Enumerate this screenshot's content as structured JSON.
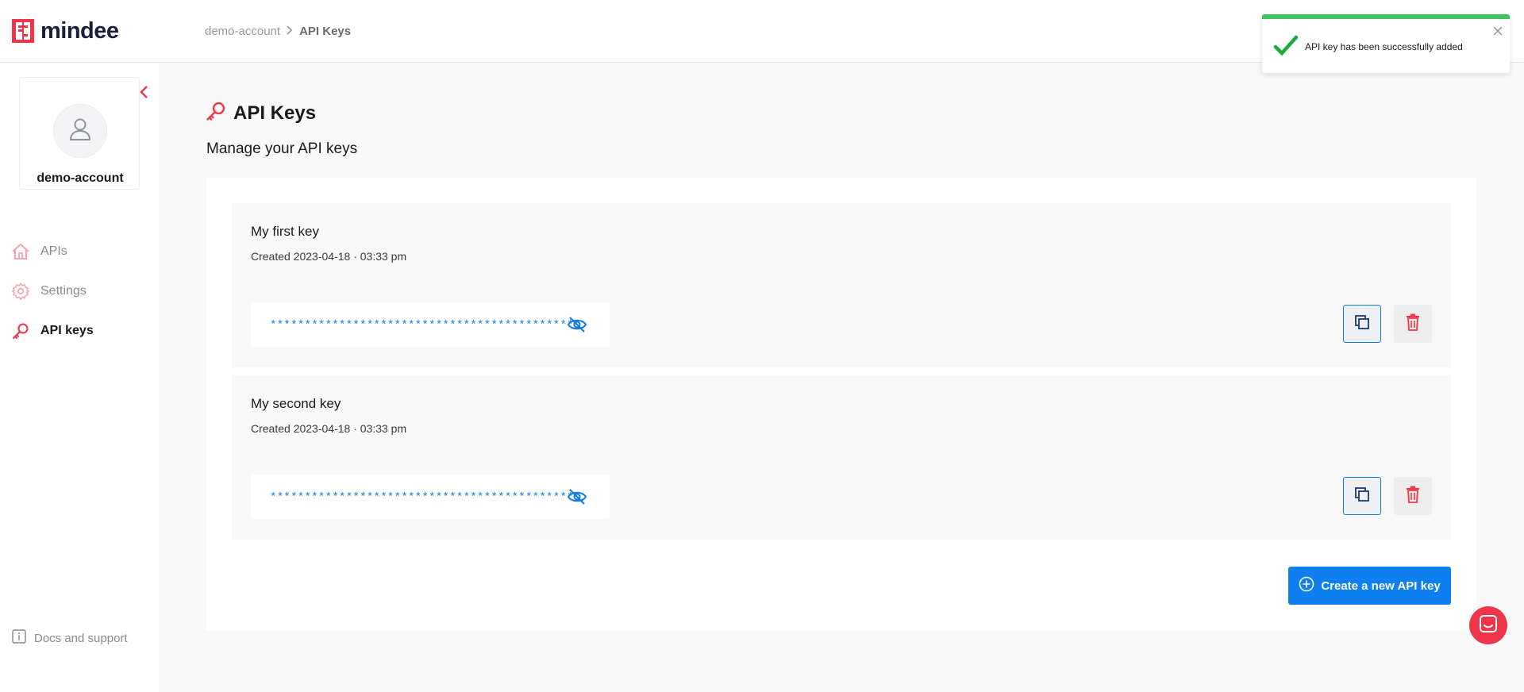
{
  "brand": {
    "name": "mindee",
    "logo_icon": "mindee-logo-icon",
    "accent": "#f0354b"
  },
  "breadcrumb": {
    "items": [
      "demo-account",
      "API Keys"
    ],
    "separator_icon": "chevron-right-icon"
  },
  "sidebar": {
    "account_name": "demo-account",
    "avatar_icon": "user-icon",
    "collapse_icon": "chevron-left-icon",
    "items": [
      {
        "label": "APIs",
        "icon": "home-icon",
        "active": false
      },
      {
        "label": "Settings",
        "icon": "gear-icon",
        "active": false
      },
      {
        "label": "API keys",
        "icon": "key-icon",
        "active": true
      }
    ],
    "docs_label": "Docs and support",
    "docs_icon": "info-icon"
  },
  "main": {
    "title": "API Keys",
    "title_icon": "key-icon",
    "subtitle": "Manage your API keys",
    "keys": [
      {
        "name": "My first key",
        "created": "Created 2023-04-18 · 03:33 pm",
        "masked_value": "********************************************"
      },
      {
        "name": "My second key",
        "created": "Created 2023-04-18 · 03:33 pm",
        "masked_value": "********************************************"
      }
    ],
    "create_button_label": "Create a new API key",
    "create_icon": "plus-circle-icon",
    "primary_color": "#0d7ff0"
  },
  "toast": {
    "message": "API key has been successfully added",
    "status_color": "#3fc35b",
    "icon": "check-icon",
    "close_icon": "close-icon"
  },
  "chat": {
    "icon": "chat-icon"
  }
}
